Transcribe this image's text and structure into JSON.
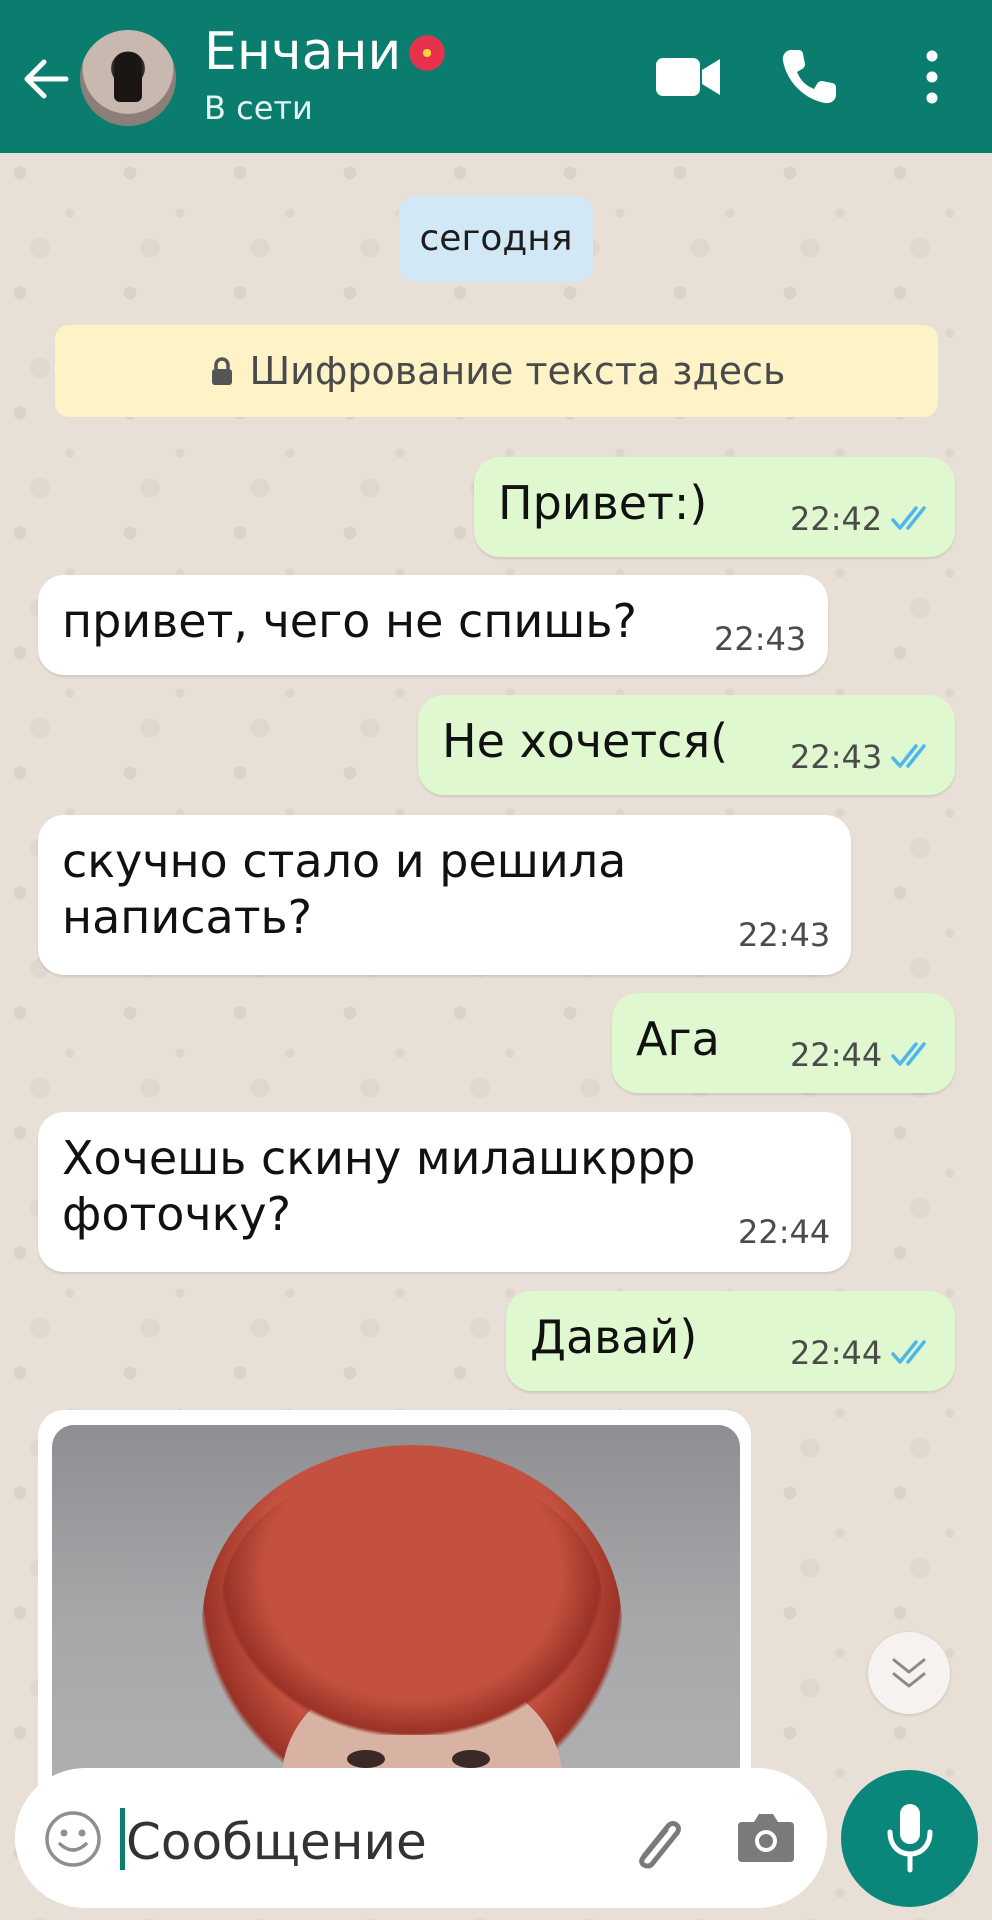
{
  "header": {
    "contact_name": "Енчани",
    "status": "В сети",
    "accent_color": "#0b7d6f",
    "icons": [
      "back-arrow-icon",
      "video-call-icon",
      "phone-call-icon",
      "more-options-icon"
    ]
  },
  "chat": {
    "date_label": "сегодня",
    "encryption_notice": "Шифрование текста здесь",
    "messages": [
      {
        "direction": "out",
        "text": "Привет:)",
        "time": "22:42",
        "read": true
      },
      {
        "direction": "in",
        "text": "привет, чего не спишь?",
        "time": "22:43"
      },
      {
        "direction": "out",
        "text": "Не хочется(",
        "time": "22:43",
        "read": true
      },
      {
        "direction": "in",
        "lines": [
          "скучно стало и решила",
          "написать?"
        ],
        "time": "22:43"
      },
      {
        "direction": "out",
        "text": "Ага",
        "time": "22:44",
        "read": true
      },
      {
        "direction": "in",
        "lines": [
          "Хочешь скину милашкррр",
          "фоточку?"
        ],
        "time": "22:44"
      },
      {
        "direction": "out",
        "text": "Давай)",
        "time": "22:44",
        "read": true
      },
      {
        "direction": "in",
        "type": "photo"
      }
    ]
  },
  "composer": {
    "placeholder": "Сообщение",
    "icons": [
      "emoji-icon",
      "attach-icon",
      "camera-icon",
      "microphone-icon"
    ]
  }
}
